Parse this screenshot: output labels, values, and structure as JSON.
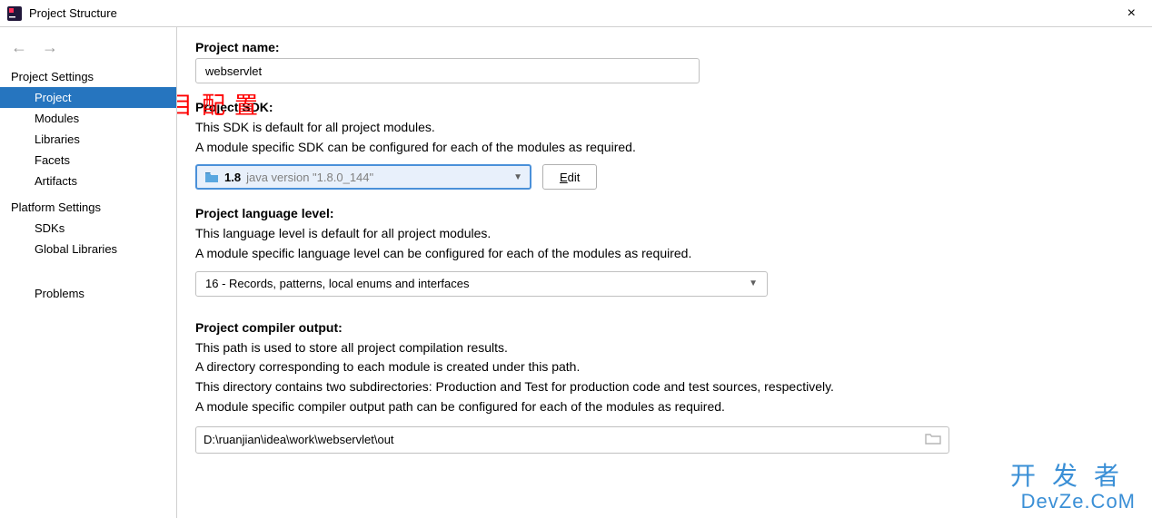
{
  "window": {
    "title": "Project Structure",
    "close": "×"
  },
  "nav": {
    "back_enabled": false,
    "forward_enabled": false
  },
  "sidebar": {
    "project_settings_header": "Project Settings",
    "platform_settings_header": "Platform Settings",
    "items": {
      "project": "Project",
      "modules": "Modules",
      "libraries": "Libraries",
      "facets": "Facets",
      "artifacts": "Artifacts",
      "sdks": "SDKs",
      "global_libraries": "Global Libraries",
      "problems": "Problems"
    },
    "selected": "project"
  },
  "project": {
    "name_label": "Project name:",
    "name_value": "webservlet",
    "sdk_label": "Project SDK:",
    "sdk_desc1": "This SDK is default for all project modules.",
    "sdk_desc2": "A module specific SDK can be configured for each of the modules as required.",
    "sdk_value_primary": "1.8",
    "sdk_value_secondary": "java version \"1.8.0_144\"",
    "edit_button": "Edit",
    "lang_label": "Project language level:",
    "lang_desc1": "This language level is default for all project modules.",
    "lang_desc2": "A module specific language level can be configured for each of the modules as required.",
    "lang_value": "16 - Records, patterns, local enums and interfaces",
    "out_label": "Project compiler output:",
    "out_desc1": "This path is used to store all project compilation results.",
    "out_desc2": "A directory corresponding to each module is created under this path.",
    "out_desc3": "This directory contains two subdirectories: Production and Test for production code and test sources, respectively.",
    "out_desc4": "A module specific compiler output path can be configured for each of the modules as required.",
    "out_value": "D:\\ruanjian\\idea\\work\\webservlet\\out"
  },
  "annotation": "项目配置",
  "watermark": {
    "cn": "开发者",
    "en": "DevZe.CoM"
  }
}
